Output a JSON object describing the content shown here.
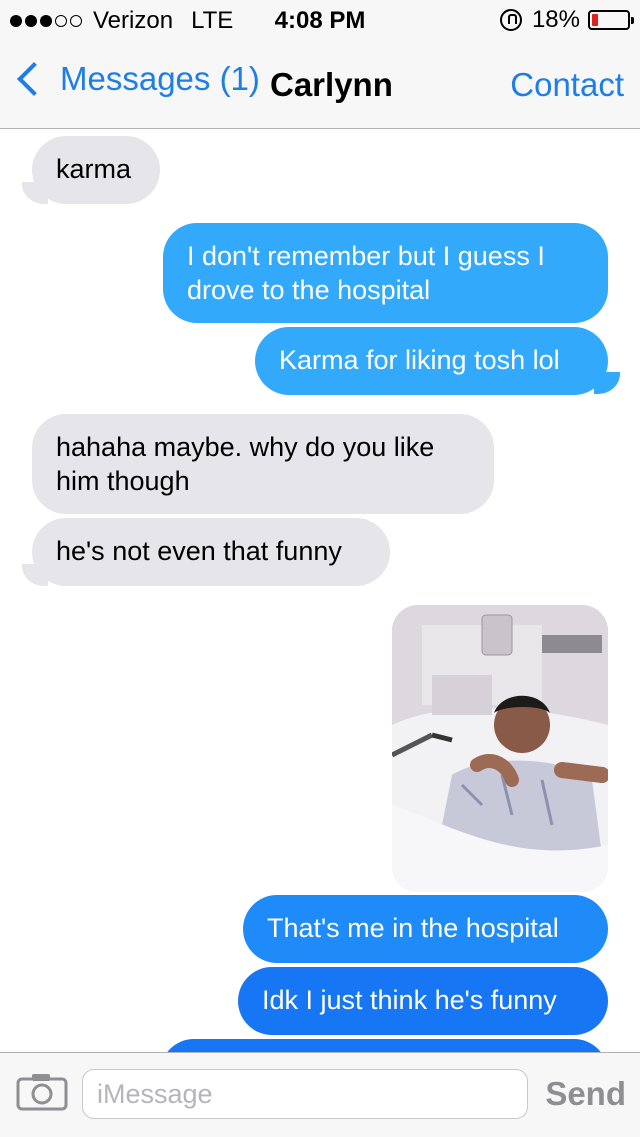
{
  "status_bar": {
    "carrier": "Verizon",
    "network": "LTE",
    "time": "4:08 PM",
    "battery_percent": "18%",
    "battery_level": 0.18,
    "signal_bars_filled": 3,
    "signal_bars_total": 5
  },
  "nav": {
    "back_label": "Messages (1)",
    "title": "Carlynn",
    "contact_label": "Contact"
  },
  "messages": [
    {
      "direction": "in",
      "text": "karma"
    },
    {
      "direction": "out",
      "text": "I don't remember but I guess I drove to the hospital"
    },
    {
      "direction": "out",
      "text": "Karma for liking tosh lol"
    },
    {
      "direction": "in",
      "text": "hahaha maybe. why do you like him though"
    },
    {
      "direction": "in",
      "text": "he's not even that funny"
    },
    {
      "direction": "out",
      "type": "photo"
    },
    {
      "direction": "out",
      "text": "That's me in the hospital"
    },
    {
      "direction": "out",
      "text": "Idk I just think he's funny"
    }
  ],
  "input": {
    "placeholder": "iMessage",
    "value": "",
    "send_label": "Send"
  },
  "icons": {
    "back": "chevron-left-icon",
    "camera": "camera-icon",
    "lock": "rotation-lock-icon",
    "battery": "battery-icon"
  },
  "colors": {
    "accent": "#1f7ee6",
    "incoming_bubble": "#e5e5ea",
    "outgoing_light": "#33a9fb",
    "outgoing_mid": "#1f8bf8",
    "outgoing_deep": "#1776f4",
    "battery_low": "#e0201b"
  }
}
